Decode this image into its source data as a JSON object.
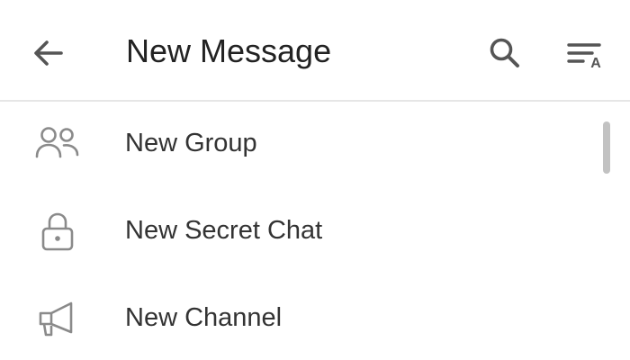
{
  "header": {
    "title": "New Message",
    "back_icon": "arrow-left-icon",
    "search_icon": "search-icon",
    "sort_icon": "sort-by-name-icon",
    "sort_icon_letter": "A"
  },
  "menu": {
    "items": [
      {
        "label": "New Group",
        "icon": "group-icon"
      },
      {
        "label": "New Secret Chat",
        "icon": "lock-icon"
      },
      {
        "label": "New Channel",
        "icon": "megaphone-icon"
      }
    ]
  },
  "colors": {
    "background": "#ffffff",
    "text_primary": "#222222",
    "icon_gray": "#8a8a8a",
    "divider": "#e6e6e6",
    "scrollbar": "#c2c2c2"
  }
}
